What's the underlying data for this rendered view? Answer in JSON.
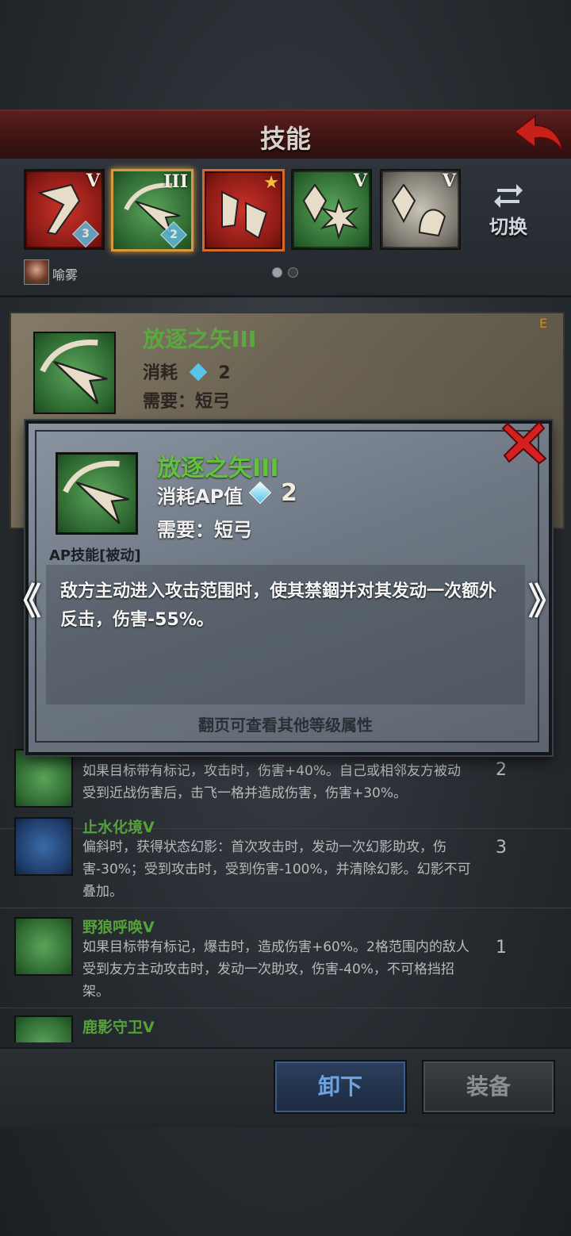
{
  "header": {
    "title": "技能"
  },
  "skill_slots": [
    {
      "color": "red",
      "level": "V",
      "gem": "3"
    },
    {
      "color": "green",
      "level": "III",
      "gem": "2",
      "selected": true
    },
    {
      "color": "red",
      "level": "",
      "star": true
    },
    {
      "color": "green",
      "level": "V"
    },
    {
      "color": "gray",
      "level": "V"
    }
  ],
  "switch_button": {
    "label": "切换",
    "icon": "swap-arrows-icon"
  },
  "hero": {
    "name": "喻雾"
  },
  "page_dots": {
    "count": 2,
    "active": 0
  },
  "back_card": {
    "title": "放逐之矢III",
    "cost_label": "消耗",
    "cost_value": "2",
    "require": "需要：短弓",
    "corner": "E"
  },
  "skill_list": [
    {
      "title": "",
      "desc": "如果目标带有标记，攻击时，伤害+40%。自己或相邻友方被动受到近战伤害后，击飞一格并造成伤害，伤害+30%。",
      "cost": "2",
      "color": "green"
    },
    {
      "title": "止水化境V",
      "desc": "偏斜时，获得状态幻影：首次攻击时，发动一次幻影助攻，伤害-30%；受到攻击时，受到伤害-100%，并清除幻影。幻影不可叠加。",
      "cost": "3",
      "color": "blue"
    },
    {
      "title": "野狼呼唤V",
      "desc": "如果目标带有标记，爆击时，造成伤害+60%。2格范围内的敌人受到友方主动攻击时，发动一次助攻，伤害-40%，不可格挡招架。",
      "cost": "1",
      "color": "green"
    },
    {
      "title": "鹿影守卫V",
      "desc": "",
      "cost": "",
      "color": "green"
    }
  ],
  "buttons": {
    "unequip": "卸下",
    "equip": "装备"
  },
  "modal": {
    "title": "放逐之矢III",
    "cost_label": "消耗AP值",
    "cost_value": "2",
    "require": "需要：短弓",
    "type": "AP技能[被动]",
    "description": "敌方主动进入攻击范围时，使其禁錮并对其发动一次额外反击，伤害-55%。",
    "hint": "翻页可查看其他等级属性",
    "prev": "《",
    "next": "》"
  },
  "colors": {
    "header_red": "#401414",
    "skill_title_green": "#62c23e",
    "unequip_blue": "#6fa3e0",
    "close_red": "#d42020"
  }
}
